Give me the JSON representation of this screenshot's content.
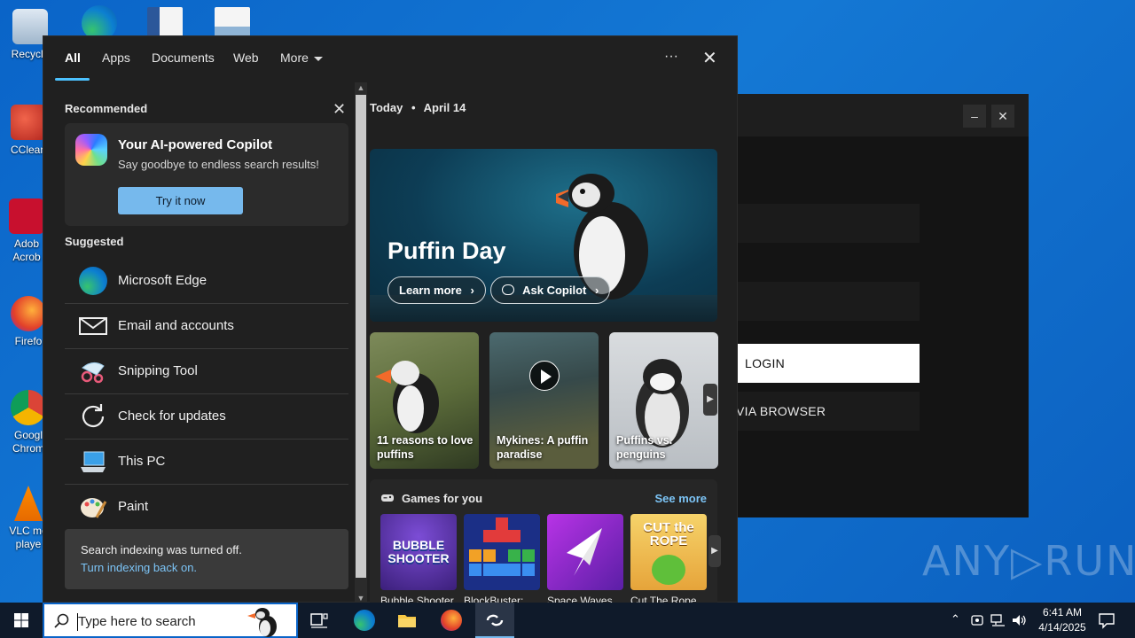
{
  "desktop": {
    "icons": [
      {
        "label": "Recycle"
      },
      {
        "label": "CClean"
      },
      {
        "label": "Adob Acrob"
      },
      {
        "label": "Firefo"
      },
      {
        "label": "Googl Chrom"
      },
      {
        "label": "VLC me playe"
      }
    ]
  },
  "background_window": {
    "minimize": "–",
    "close": "✕",
    "login_label": "LOGIN",
    "via_browser_label": "VIA BROWSER"
  },
  "watermark": "ANY▷RUN",
  "search": {
    "tabs": [
      "All",
      "Apps",
      "Documents",
      "Web",
      "More"
    ],
    "active_tab": "All",
    "more_options": "···",
    "close": "✕",
    "recommended": {
      "title": "Recommended",
      "copilot_title": "Your AI-powered Copilot",
      "copilot_sub": "Say goodbye to endless search results!",
      "try_button": "Try it now"
    },
    "suggested": {
      "title": "Suggested",
      "items": [
        {
          "label": "Microsoft Edge",
          "icon": "edge-icon"
        },
        {
          "label": "Email and accounts",
          "icon": "mail-icon"
        },
        {
          "label": "Snipping Tool",
          "icon": "snipping-tool-icon"
        },
        {
          "label": "Check for updates",
          "icon": "refresh-icon"
        },
        {
          "label": "This PC",
          "icon": "computer-icon"
        },
        {
          "label": "Paint",
          "icon": "paint-icon"
        }
      ]
    },
    "indexing": {
      "line1": "Search indexing was turned off.",
      "line2": "Turn indexing back on."
    },
    "today": {
      "label": "Today",
      "date": "April 14",
      "hero_title": "Puffin Day",
      "learn_more": "Learn more",
      "ask_copilot": "Ask Copilot"
    },
    "cards": [
      {
        "caption": "11 reasons to love puffins"
      },
      {
        "caption": "Mykines: A puffin paradise"
      },
      {
        "caption": "Puffins vs. penguins"
      }
    ],
    "games": {
      "title": "Games for you",
      "see_more": "See more",
      "items": [
        {
          "label": "Bubble Shooter",
          "art": "BUBBLE SHOOTER"
        },
        {
          "label": "BlockBuster:",
          "art": ""
        },
        {
          "label": "Space Waves",
          "art": ""
        },
        {
          "label": "Cut The Rope",
          "art": "CUT the ROPE"
        }
      ]
    }
  },
  "taskbar": {
    "search_placeholder": "Type here to search",
    "time": "6:41 AM",
    "date": "4/14/2025"
  },
  "colors": {
    "accent": "#4cc2ff",
    "link": "#7cc4f6",
    "button": "#76b9ed",
    "flyout_bg": "#202020",
    "taskbar_bg": "#0f1a2a"
  }
}
